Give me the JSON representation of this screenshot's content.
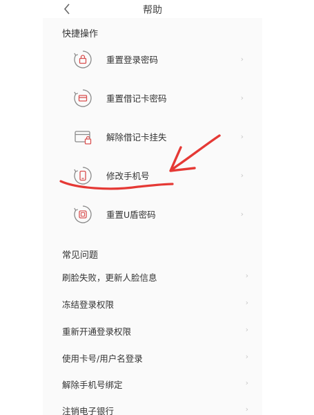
{
  "header": {
    "title": "帮助",
    "back_icon": "chevron-left-icon"
  },
  "quick": {
    "title": "快捷操作",
    "items": [
      {
        "label": "重置登录密码",
        "icon": "lock-icon"
      },
      {
        "label": "重置借记卡密码",
        "icon": "card-icon"
      },
      {
        "label": "解除借记卡挂失",
        "icon": "card-unlock-icon"
      },
      {
        "label": "修改手机号",
        "icon": "phone-icon"
      },
      {
        "label": "重置U盾密码",
        "icon": "usb-key-icon"
      }
    ]
  },
  "faq": {
    "title": "常见问题",
    "items": [
      {
        "label": "刷脸失败，更新人脸信息"
      },
      {
        "label": "冻结登录权限"
      },
      {
        "label": "重新开通登录权限"
      },
      {
        "label": "使用卡号/用户名登录"
      },
      {
        "label": "解除手机号绑定"
      },
      {
        "label": "注销电子银行"
      }
    ]
  },
  "chevron": "›",
  "colors": {
    "accent": "#d94f4f",
    "icon_gray": "#8a8a8a",
    "annotation": "#e53935"
  }
}
